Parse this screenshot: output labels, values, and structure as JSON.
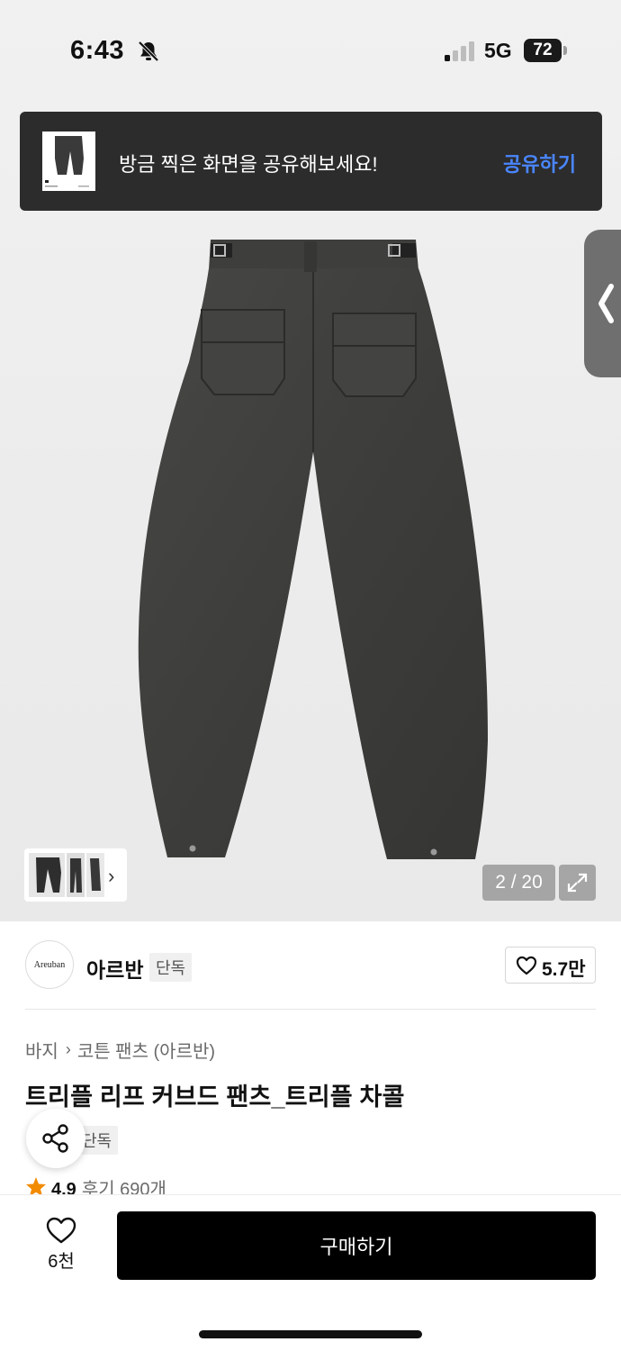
{
  "status_bar": {
    "time": "6:43",
    "network": "5G",
    "battery": "72"
  },
  "toast": {
    "message": "방금 찍은 화면을 공유해보세요!",
    "action": "공유하기"
  },
  "gallery": {
    "counter": "2 / 20"
  },
  "brand": {
    "logo_text": "Areuban",
    "name": "아르반",
    "badge": "단독",
    "likes": "5.7만"
  },
  "breadcrumb": {
    "category": "바지",
    "subcategory": "코튼 팬츠 (아르반)"
  },
  "product": {
    "title": "트리플 리프 커브드 팬츠_트리플 차콜",
    "badge": "단독",
    "rating": "4.9",
    "reviews": "후기 690개"
  },
  "bottom_bar": {
    "wish_count": "6천",
    "buy_label": "구매하기"
  },
  "colors": {
    "accent_link": "#4a86ff",
    "toast_bg": "#2c2c2c",
    "buy_button": "#000000",
    "star": "#f28b00"
  }
}
